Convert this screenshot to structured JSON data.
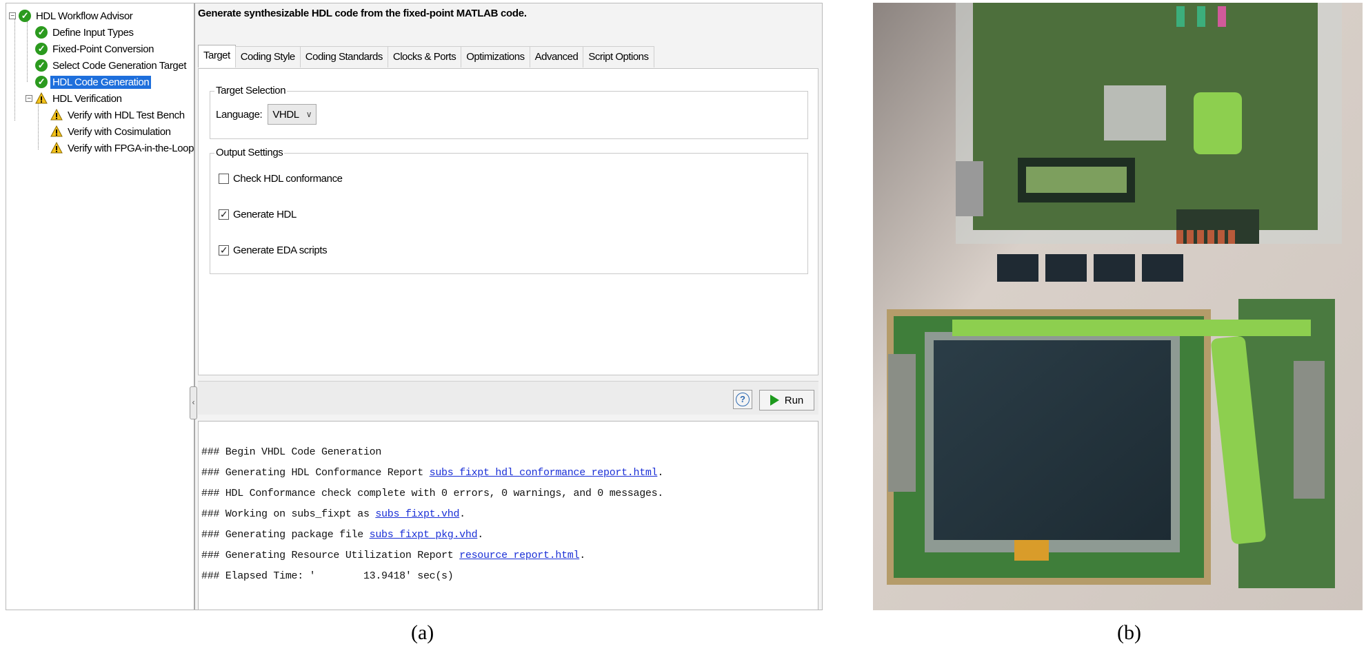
{
  "tree": {
    "root": "HDL Workflow Advisor",
    "items": [
      {
        "label": "Define Input Types",
        "status": "check-icon"
      },
      {
        "label": "Fixed-Point Conversion",
        "status": "check-icon"
      },
      {
        "label": "Select Code Generation Target",
        "status": "check-icon"
      },
      {
        "label": "HDL Code Generation",
        "status": "check-icon",
        "selected": true
      }
    ],
    "verification": {
      "label": "HDL Verification",
      "status": "warning-icon",
      "items": [
        {
          "label": "Verify with HDL Test Bench",
          "status": "warning-icon"
        },
        {
          "label": "Verify with Cosimulation",
          "status": "warning-icon"
        },
        {
          "label": "Verify with FPGA-in-the-Loop",
          "status": "warning-icon"
        }
      ]
    }
  },
  "main": {
    "headline": "Generate synthesizable HDL code from the fixed-point MATLAB code.",
    "tabs": [
      "Target",
      "Coding Style",
      "Coding Standards",
      "Clocks & Ports",
      "Optimizations",
      "Advanced",
      "Script Options"
    ],
    "active_tab": "Target",
    "target_selection": {
      "title": "Target Selection",
      "language_label": "Language:",
      "language_value": "VHDL"
    },
    "output_settings": {
      "title": "Output Settings",
      "options": [
        {
          "label": "Check HDL conformance",
          "checked": false
        },
        {
          "label": "Generate HDL",
          "checked": true
        },
        {
          "label": "Generate EDA scripts",
          "checked": true
        }
      ]
    },
    "run_label": "Run"
  },
  "log": {
    "lines": [
      {
        "text": "### Begin VHDL Code Generation",
        "link": "",
        "suffix": ""
      },
      {
        "text": "### Generating HDL Conformance Report ",
        "link": "subs_fixpt_hdl_conformance_report.html",
        "suffix": "."
      },
      {
        "text": "### HDL Conformance check complete with 0 errors, 0 warnings, and 0 messages.",
        "link": "",
        "suffix": ""
      },
      {
        "text": "### Working on subs_fixpt as ",
        "link": "subs_fixpt.vhd",
        "suffix": "."
      },
      {
        "text": "### Generating package file ",
        "link": "subs_fixpt_pkg.vhd",
        "suffix": "."
      },
      {
        "text": "### Generating Resource Utilization Report ",
        "link": "resource_report.html",
        "suffix": "."
      },
      {
        "text": "### Elapsed Time: '        13.9418' sec(s)",
        "link": "",
        "suffix": ""
      }
    ]
  },
  "captions": {
    "a": "(a)",
    "b": "(b)"
  },
  "colors": {
    "check_green": "#2b9a1e",
    "selection_blue": "#1e6fdc",
    "link_blue": "#1a2fd6",
    "highlight_green": "#8dcf4f",
    "board_green": "#3f6f35"
  }
}
